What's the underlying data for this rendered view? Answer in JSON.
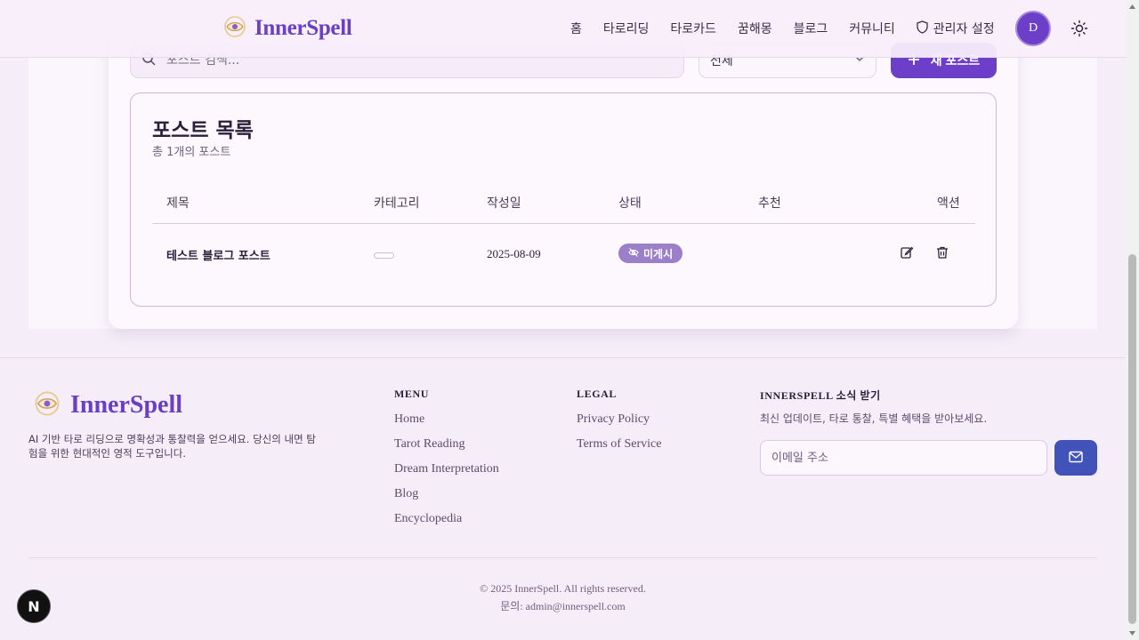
{
  "header": {
    "brand": "InnerSpell",
    "nav": [
      "홈",
      "타로리딩",
      "타로카드",
      "꿈해몽",
      "블로그",
      "커뮤니티"
    ],
    "admin_label": "관리자 설정",
    "avatar_initial": "D"
  },
  "toolbar": {
    "search_placeholder": "포스트 검색...",
    "filter_value": "전체",
    "new_post_label": "새 포스트"
  },
  "post_list": {
    "title": "포스트 목록",
    "subtitle": "총 1개의 포스트",
    "columns": [
      "제목",
      "카테고리",
      "작성일",
      "상태",
      "추천",
      "액션"
    ],
    "rows": [
      {
        "title": "테스트 블로그 포스트",
        "category": "",
        "date": "2025-08-09",
        "status": "미게시",
        "featured": ""
      }
    ]
  },
  "footer": {
    "brand": "InnerSpell",
    "description": "AI 기반 타로 리딩으로 명확성과 통찰력을 얻으세요. 당신의 내면 탐험을 위한 현대적인 영적 도구입니다.",
    "menu_title": "MENU",
    "menu": [
      "Home",
      "Tarot Reading",
      "Dream Interpretation",
      "Blog",
      "Encyclopedia"
    ],
    "legal_title": "LEGAL",
    "legal": [
      "Privacy Policy",
      "Terms of Service"
    ],
    "newsletter_title": "INNERSPELL 소식 받기",
    "newsletter_sub": "최신 업데이트, 타로 통찰, 특별 혜택을 받아보세요.",
    "email_placeholder": "이메일 주소",
    "copyright": "© 2025 InnerSpell. All rights reserved.",
    "contact": "문의: admin@innerspell.com"
  },
  "dev_badge": "N",
  "colors": {
    "accent": "#6d3fc9",
    "badge": "#9b7fc9",
    "subscribe": "#4153b8"
  },
  "icons": [
    "search-icon",
    "chevron-down-icon",
    "plus-icon",
    "eye-off-icon",
    "edit-icon",
    "trash-icon",
    "shield-icon",
    "sun-icon",
    "mail-icon",
    "eye-logo-icon"
  ]
}
